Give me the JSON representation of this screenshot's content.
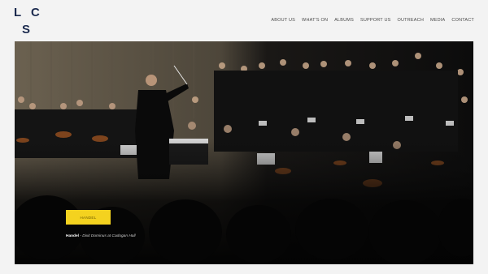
{
  "logo": {
    "letters": [
      "L",
      "C",
      "S"
    ]
  },
  "nav": {
    "items": [
      {
        "label": "ABOUT US",
        "name": "nav-about-us"
      },
      {
        "label": "WHAT'S ON",
        "name": "nav-whats-on"
      },
      {
        "label": "ALBUMS",
        "name": "nav-albums"
      },
      {
        "label": "SUPPORT US",
        "name": "nav-support-us"
      },
      {
        "label": "OUTREACH",
        "name": "nav-outreach"
      },
      {
        "label": "MEDIA",
        "name": "nav-media"
      },
      {
        "label": "CONTACT",
        "name": "nav-contact"
      }
    ]
  },
  "hero": {
    "cta_label": "HANDEL",
    "caption_title": "Handel",
    "caption_sep": " - ",
    "caption_subtitle": "Dixit Dominus at Cadogan Hall"
  },
  "colors": {
    "background": "#f3f3f3",
    "logo": "#1b2a4e",
    "cta": "#f4d21f",
    "hero_bg": "#0b0b0b"
  }
}
